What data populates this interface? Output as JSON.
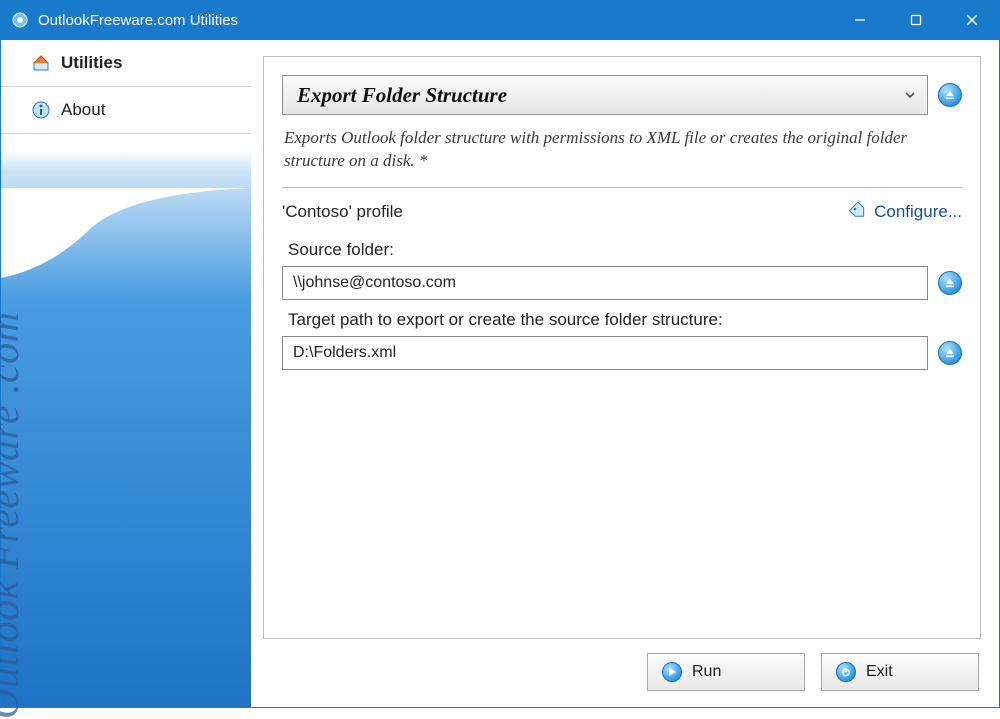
{
  "window": {
    "title": "OutlookFreeware.com Utilities"
  },
  "sidebar": {
    "tabs": [
      {
        "label": "Utilities"
      },
      {
        "label": "About"
      }
    ],
    "brand": "Outlook Freeware .com"
  },
  "panel": {
    "title": "Export Folder Structure",
    "description": "Exports Outlook folder structure with permissions to XML file or creates the original folder structure on a disk. *",
    "profile": "'Contoso' profile",
    "configure": "Configure...",
    "source_label": "Source folder:",
    "source_value": "\\\\johnse@contoso.com",
    "target_label": "Target path to export or create the source folder structure:",
    "target_value": "D:\\Folders.xml"
  },
  "buttons": {
    "run": "Run",
    "exit": "Exit"
  }
}
